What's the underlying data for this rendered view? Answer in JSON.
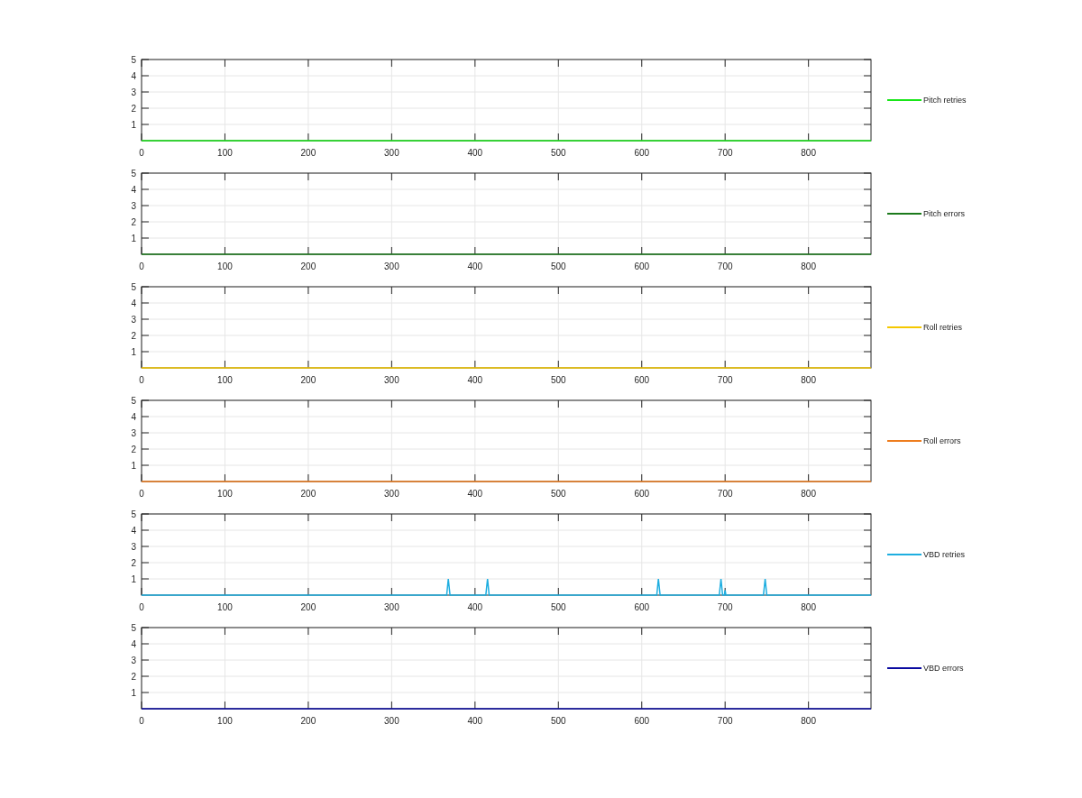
{
  "charts": [
    {
      "chart_data": {
        "type": "line",
        "x": [
          0,
          875
        ],
        "series": [
          {
            "name": "Pitch retries",
            "color": "#19e619",
            "values": [
              0,
              0
            ]
          }
        ],
        "xlim": [
          0,
          875
        ],
        "ylim": [
          0,
          5
        ],
        "xticks": [
          0,
          100,
          200,
          300,
          400,
          500,
          600,
          700,
          800
        ],
        "yticks": [
          1,
          2,
          3,
          4,
          5
        ],
        "grid": true
      }
    },
    {
      "chart_data": {
        "type": "line",
        "x": [
          0,
          875
        ],
        "series": [
          {
            "name": "Pitch errors",
            "color": "#1c7a1c",
            "values": [
              0,
              0
            ]
          }
        ],
        "xlim": [
          0,
          875
        ],
        "ylim": [
          0,
          5
        ],
        "xticks": [
          0,
          100,
          200,
          300,
          400,
          500,
          600,
          700,
          800
        ],
        "yticks": [
          1,
          2,
          3,
          4,
          5
        ],
        "grid": true
      }
    },
    {
      "chart_data": {
        "type": "line",
        "x": [
          0,
          875
        ],
        "series": [
          {
            "name": "Roll retries",
            "color": "#f5c800",
            "values": [
              0,
              0
            ]
          }
        ],
        "xlim": [
          0,
          875
        ],
        "ylim": [
          0,
          5
        ],
        "xticks": [
          0,
          100,
          200,
          300,
          400,
          500,
          600,
          700,
          800
        ],
        "yticks": [
          1,
          2,
          3,
          4,
          5
        ],
        "grid": true
      }
    },
    {
      "chart_data": {
        "type": "line",
        "x": [
          0,
          875
        ],
        "series": [
          {
            "name": "Roll errors",
            "color": "#ee7d1e",
            "values": [
              0,
              0
            ]
          }
        ],
        "xlim": [
          0,
          875
        ],
        "ylim": [
          0,
          5
        ],
        "xticks": [
          0,
          100,
          200,
          300,
          400,
          500,
          600,
          700,
          800
        ],
        "yticks": [
          1,
          2,
          3,
          4,
          5
        ],
        "grid": true
      }
    },
    {
      "chart_data": {
        "type": "line",
        "x": [
          0,
          366,
          368,
          370,
          413,
          415,
          417,
          618,
          620,
          622,
          693,
          695,
          697,
          699,
          700,
          701,
          746,
          748,
          750,
          875
        ],
        "series": [
          {
            "name": "VBD retries",
            "color": "#1eaee0",
            "values": [
              0,
              0,
              1,
              0,
              0,
              1,
              0,
              0,
              1,
              0,
              0,
              1,
              0,
              0,
              0.3,
              0,
              0,
              1,
              0,
              0
            ]
          }
        ],
        "xlim": [
          0,
          875
        ],
        "ylim": [
          0,
          5
        ],
        "xticks": [
          0,
          100,
          200,
          300,
          400,
          500,
          600,
          700,
          800
        ],
        "yticks": [
          1,
          2,
          3,
          4,
          5
        ],
        "grid": true
      }
    },
    {
      "chart_data": {
        "type": "line",
        "x": [
          0,
          875
        ],
        "series": [
          {
            "name": "VBD errors",
            "color": "#0a0aa0",
            "values": [
              0,
              0
            ]
          }
        ],
        "xlim": [
          0,
          875
        ],
        "ylim": [
          0,
          5
        ],
        "xticks": [
          0,
          100,
          200,
          300,
          400,
          500,
          600,
          700,
          800
        ],
        "yticks": [
          1,
          2,
          3,
          4,
          5
        ],
        "grid": true
      }
    }
  ]
}
